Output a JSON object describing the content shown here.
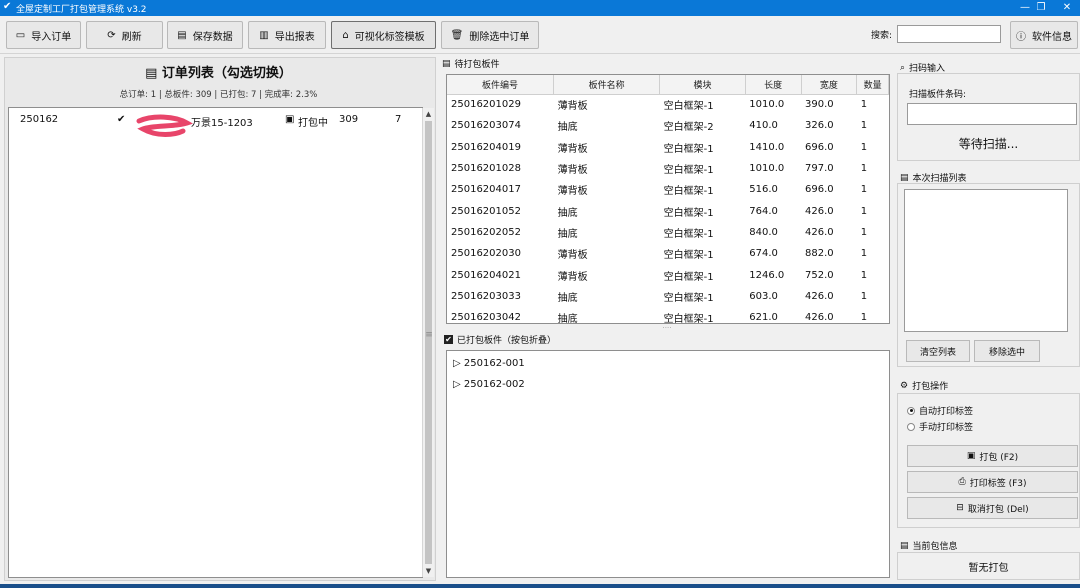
{
  "window": {
    "title": "全屋定制工厂打包管理系统 v3.2"
  },
  "toolbar": {
    "import": "导入订单",
    "refresh": "刷新",
    "save": "保存数据",
    "export": "导出报表",
    "template": "可视化标签模板",
    "delete": "删除选中订单",
    "search_label": "搜索:",
    "search_value": "",
    "about": "软件信息"
  },
  "orders": {
    "title": "订单列表（勾选切换）",
    "stats": "总订单: 1 | 总板件: 309 | 已打包: 7 | 完成率: 2.3%",
    "rows": [
      {
        "id": "250162",
        "checked": "✔",
        "name": "万景15-1203",
        "status": "打包中",
        "total": "309",
        "packed": "7"
      }
    ]
  },
  "pending": {
    "label": "待打包板件",
    "columns": [
      "板件编号",
      "板件名称",
      "模块",
      "长度",
      "宽度",
      "数量"
    ],
    "rows": [
      [
        "25016201029",
        "薄背板",
        "空白框架-1",
        "1010.0",
        "390.0",
        "1"
      ],
      [
        "25016203074",
        "抽底",
        "空白框架-2",
        "410.0",
        "326.0",
        "1"
      ],
      [
        "25016204019",
        "薄背板",
        "空白框架-1",
        "1410.0",
        "696.0",
        "1"
      ],
      [
        "25016201028",
        "薄背板",
        "空白框架-1",
        "1010.0",
        "797.0",
        "1"
      ],
      [
        "25016204017",
        "薄背板",
        "空白框架-1",
        "516.0",
        "696.0",
        "1"
      ],
      [
        "25016201052",
        "抽底",
        "空白框架-1",
        "764.0",
        "426.0",
        "1"
      ],
      [
        "25016202052",
        "抽底",
        "空白框架-1",
        "840.0",
        "426.0",
        "1"
      ],
      [
        "25016202030",
        "薄背板",
        "空白框架-1",
        "674.0",
        "882.0",
        "1"
      ],
      [
        "25016204021",
        "薄背板",
        "空白框架-1",
        "1246.0",
        "752.0",
        "1"
      ],
      [
        "25016203033",
        "抽底",
        "空白框架-1",
        "603.0",
        "426.0",
        "1"
      ],
      [
        "25016203042",
        "抽底",
        "空白框架-1",
        "621.0",
        "426.0",
        "1"
      ]
    ]
  },
  "packed": {
    "label": "已打包板件（按包折叠）",
    "items": [
      "250162-001",
      "250162-002"
    ]
  },
  "scan": {
    "group": "扫码输入",
    "field_label": "扫描板件条码:",
    "value": "",
    "waiting": "等待扫描...",
    "list_label": "本次扫描列表",
    "clear": "清空列表",
    "remove": "移除选中"
  },
  "pack": {
    "group": "打包操作",
    "auto": "自动打印标签",
    "manual": "手动打印标签",
    "pack_btn": "打包 (F2)",
    "print_btn": "打印标签 (F3)",
    "cancel_btn": "取消打包 (Del)"
  },
  "current": {
    "group": "当前包信息",
    "value": "暂无打包"
  }
}
